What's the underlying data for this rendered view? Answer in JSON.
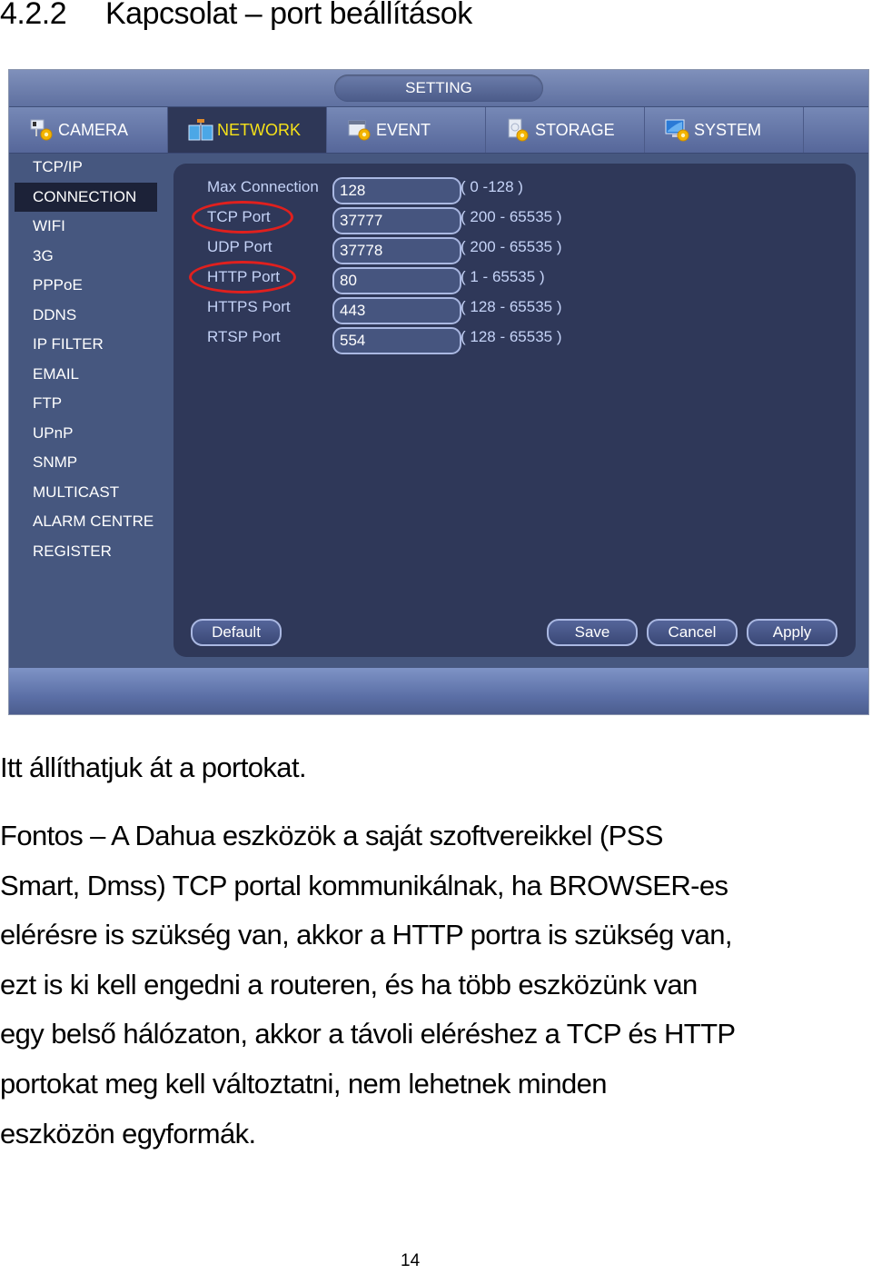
{
  "heading": {
    "number": "4.2.2",
    "title": "Kapcsolat – port beállítások"
  },
  "dvr": {
    "title": "SETTING",
    "tabs": [
      {
        "label": "CAMERA",
        "icon": "camera-gear-icon",
        "active": false
      },
      {
        "label": "NETWORK",
        "icon": "network-icon",
        "active": true
      },
      {
        "label": "EVENT",
        "icon": "event-gear-icon",
        "active": false
      },
      {
        "label": "STORAGE",
        "icon": "storage-gear-icon",
        "active": false
      },
      {
        "label": "SYSTEM",
        "icon": "system-monitor-icon",
        "active": false
      }
    ],
    "sidebar": [
      {
        "label": "TCP/IP",
        "active": false
      },
      {
        "label": "CONNECTION",
        "active": true
      },
      {
        "label": "WIFI",
        "active": false
      },
      {
        "label": "3G",
        "active": false
      },
      {
        "label": "PPPoE",
        "active": false
      },
      {
        "label": "DDNS",
        "active": false
      },
      {
        "label": "IP FILTER",
        "active": false
      },
      {
        "label": "EMAIL",
        "active": false
      },
      {
        "label": "FTP",
        "active": false
      },
      {
        "label": "UPnP",
        "active": false
      },
      {
        "label": "SNMP",
        "active": false
      },
      {
        "label": "MULTICAST",
        "active": false
      },
      {
        "label": "ALARM CENTRE",
        "active": false
      },
      {
        "label": "REGISTER",
        "active": false
      }
    ],
    "fields": [
      {
        "label": "Max Connection",
        "value": "128",
        "range": "( 0 -128 )",
        "highlighted": false
      },
      {
        "label": "TCP Port",
        "value": "37777",
        "range": "( 200 - 65535 )",
        "highlighted": true
      },
      {
        "label": "UDP Port",
        "value": "37778",
        "range": "( 200 - 65535 )",
        "highlighted": false
      },
      {
        "label": "HTTP Port",
        "value": "80",
        "range": "( 1 - 65535 )",
        "highlighted": true
      },
      {
        "label": "HTTPS Port",
        "value": "443",
        "range": "( 128 - 65535 )",
        "highlighted": false
      },
      {
        "label": "RTSP Port",
        "value": "554",
        "range": "( 128 - 65535 )",
        "highlighted": false
      }
    ],
    "buttons": {
      "default": "Default",
      "save": "Save",
      "cancel": "Cancel",
      "apply": "Apply"
    },
    "colors": {
      "active_tab_text": "#f5e11a",
      "highlight_ring": "#e0201e",
      "label_text": "#c5d3f7"
    }
  },
  "body": {
    "intro": "Itt állíthatjuk át a portokat.",
    "lines": [
      "Fontos – A Dahua eszközök a saját szoftvereikkel (PSS",
      "Smart, Dmss) TCP portal kommunikálnak, ha BROWSER-es",
      "elérésre is szükség van, akkor a HTTP portra is szükség van,",
      "ezt is ki kell engedni a routeren, és ha több eszközünk van",
      "egy belső hálózaton, akkor a távoli eléréshez a TCP és HTTP",
      "portokat meg kell változtatni, nem lehetnek minden",
      "eszközön egyformák."
    ]
  },
  "page_number": "14"
}
